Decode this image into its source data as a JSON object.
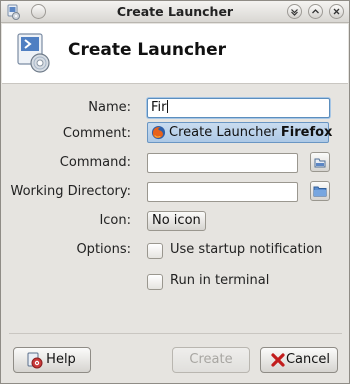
{
  "window": {
    "title": "Create Launcher"
  },
  "header": {
    "title": "Create Launcher"
  },
  "form": {
    "name_label": "Name:",
    "name_value": "Fir",
    "comment_label": "Comment:",
    "command_label": "Command:",
    "command_value": "",
    "working_dir_label": "Working Directory:",
    "working_dir_value": "",
    "icon_label": "Icon:",
    "icon_button": "No icon",
    "options_label": "Options:",
    "startup_notification_label": "Use startup notification",
    "startup_notification_checked": false,
    "run_in_terminal_label": "Run in terminal",
    "run_in_terminal_checked": false
  },
  "autocomplete": {
    "prefix": "Create Launcher ",
    "match": "Firefox"
  },
  "buttons": {
    "help": "Help",
    "create": "Create",
    "cancel": "Cancel"
  },
  "icons": {
    "app_icon": "launcher-icon",
    "firefox": "firefox-icon",
    "browse_file": "file-browse-icon",
    "browse_folder": "folder-icon",
    "help": "help-icon",
    "cancel": "cancel-icon"
  }
}
